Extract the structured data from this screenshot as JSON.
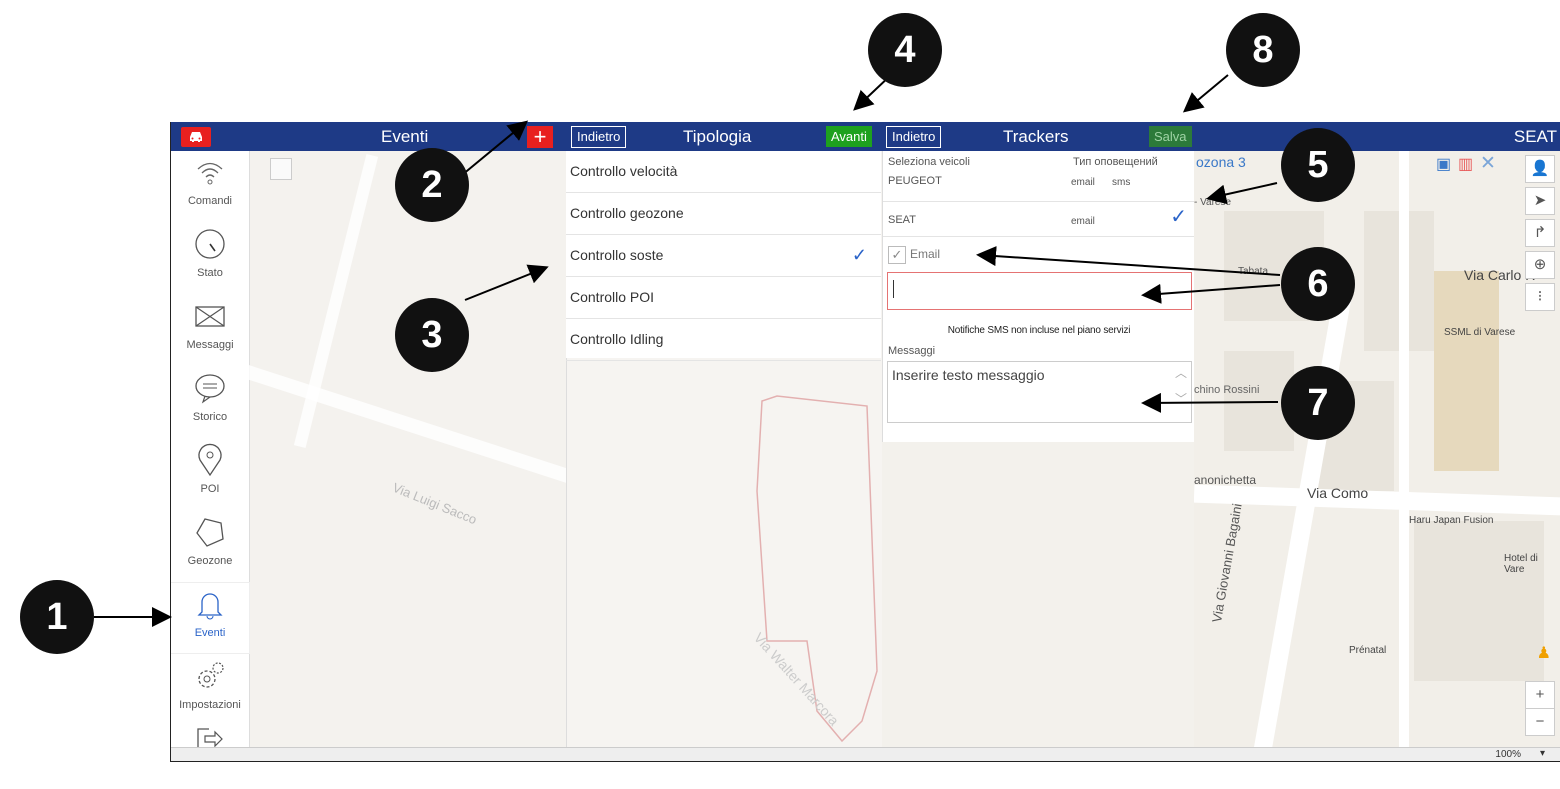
{
  "topbar": {
    "eventi_title": "Eventi",
    "add_symbol": "+",
    "back1": "Indietro",
    "tipologia_title": "Tipologia",
    "forward": "Avanti",
    "back2": "Indietro",
    "trackers_title": "Trackers",
    "save": "Salva",
    "vehicle": "SEAT"
  },
  "sidebar": {
    "items": [
      {
        "label": "Comandi",
        "icon": "wifi-icon"
      },
      {
        "label": "Stato",
        "icon": "gauge-icon"
      },
      {
        "label": "Messaggi",
        "icon": "envelope-icon"
      },
      {
        "label": "Storico",
        "icon": "chat-bubble-icon"
      },
      {
        "label": "POI",
        "icon": "map-pin-icon"
      },
      {
        "label": "Geozone",
        "icon": "polygon-icon"
      },
      {
        "label": "Eventi",
        "icon": "bell-icon"
      },
      {
        "label": "Impostazioni",
        "icon": "gears-icon"
      }
    ],
    "logout_icon": "exit-icon"
  },
  "tipologia_list": [
    {
      "label": "Controllo velocità",
      "checked": false
    },
    {
      "label": "Controllo geozone",
      "checked": false
    },
    {
      "label": "Controllo soste",
      "checked": true
    },
    {
      "label": "Controllo POI",
      "checked": false
    },
    {
      "label": "Controllo Idling",
      "checked": false
    }
  ],
  "trackers_panel": {
    "select_vehicles_header": "Seleziona veicoli",
    "notification_type_header": "Тип оповещений",
    "vehicles": [
      {
        "name": "PEUGEOT",
        "email": "email",
        "sms": "sms",
        "checked": false
      },
      {
        "name": "SEAT",
        "email": "email",
        "sms": "",
        "checked": true
      }
    ],
    "email_checkbox_label": "Email",
    "email_input_value": "",
    "sms_notice": "Notifiche SMS non incluse nel piano servizi",
    "messages_label": "Messaggi",
    "message_placeholder": "Inserire testo messaggio"
  },
  "map_labels": {
    "geozone_title": "ozona 3",
    "varese": "- Varese",
    "tabata": "Tabata",
    "via_carlo": "Via Carlo R",
    "ssml": "SSML di Varese",
    "rossini": "chino Rossini",
    "canonichetta": "anonichetta",
    "via_como": "Via Como",
    "via_bagaini": "Via Giovanni Bagaini",
    "haru": "Haru Japan Fusion",
    "hotel": "Hotel di Vare",
    "prenatal": "Prénatal",
    "via_sacco": "Via Luigi Sacco",
    "via_marcora": "Via Walter Marcora"
  },
  "statusbar": {
    "zoom": "100%"
  },
  "callouts": [
    "1",
    "2",
    "3",
    "4",
    "5",
    "6",
    "7",
    "8"
  ],
  "colors": {
    "topbar": "#1e3a86",
    "red": "#e8201f",
    "green": "#1ea11e",
    "dark_green": "#2c7a3a",
    "accent_blue": "#2a63c8"
  }
}
